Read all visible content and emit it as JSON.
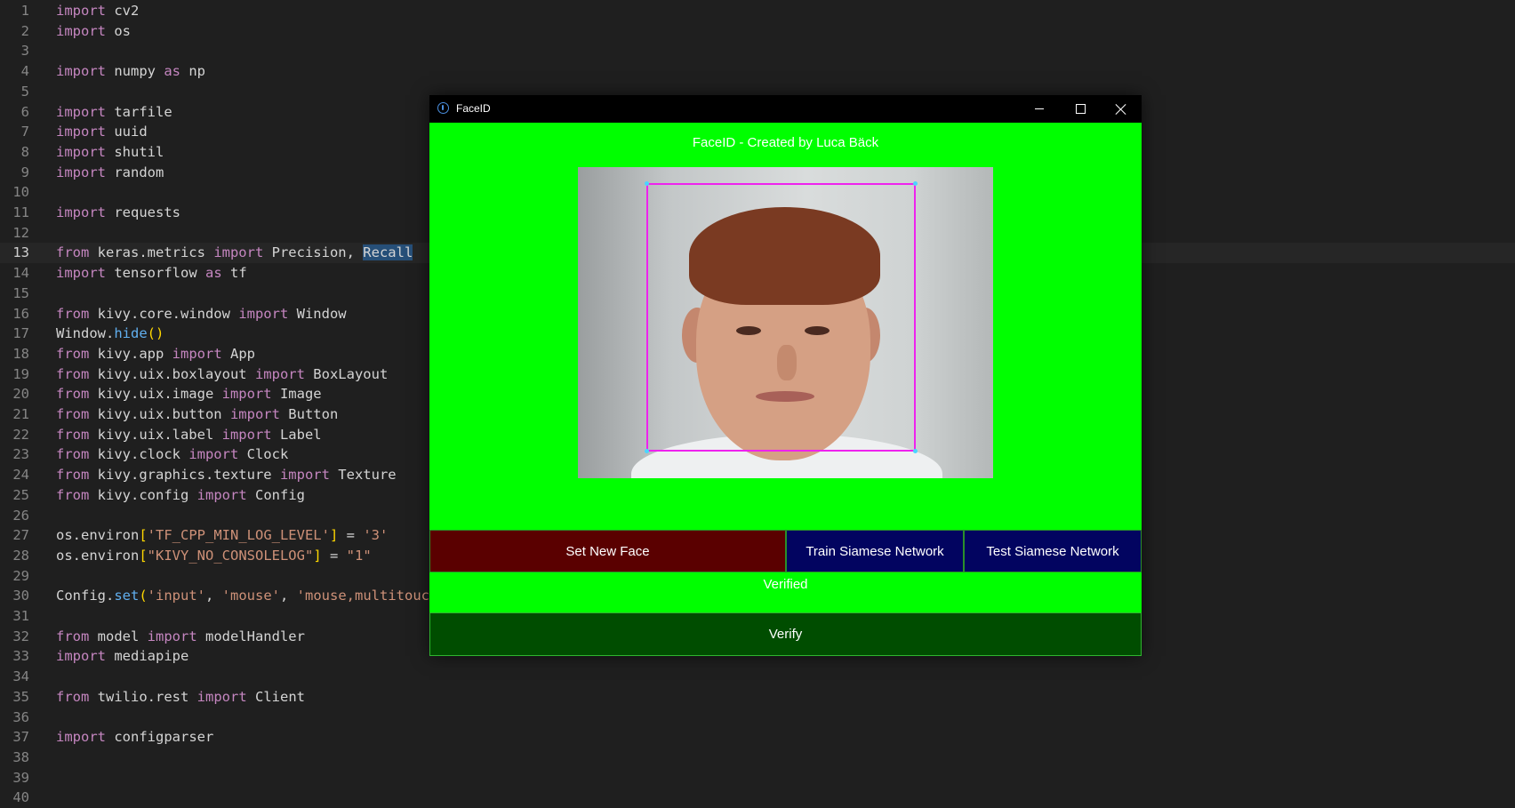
{
  "editor": {
    "current_line": 13,
    "lines": [
      [
        [
          "import",
          "kw"
        ],
        [
          " cv2",
          ""
        ]
      ],
      [
        [
          "import",
          "kw"
        ],
        [
          " os",
          ""
        ]
      ],
      [],
      [
        [
          "import",
          "kw"
        ],
        [
          " numpy ",
          ""
        ],
        [
          "as",
          "kw"
        ],
        [
          " np",
          ""
        ]
      ],
      [],
      [
        [
          "import",
          "kw"
        ],
        [
          " tarfile",
          ""
        ]
      ],
      [
        [
          "import",
          "kw"
        ],
        [
          " uuid",
          ""
        ]
      ],
      [
        [
          "import",
          "kw"
        ],
        [
          " shutil",
          ""
        ]
      ],
      [
        [
          "import",
          "kw"
        ],
        [
          " random",
          ""
        ]
      ],
      [],
      [
        [
          "import",
          "kw"
        ],
        [
          " requests",
          ""
        ]
      ],
      [],
      [
        [
          "from",
          "kw"
        ],
        [
          " keras.metrics ",
          ""
        ],
        [
          "import",
          "kw"
        ],
        [
          " Precision, ",
          ""
        ],
        [
          "Recall",
          "sel"
        ]
      ],
      [
        [
          "import",
          "kw"
        ],
        [
          " tensorflow ",
          ""
        ],
        [
          "as",
          "kw"
        ],
        [
          " tf",
          ""
        ]
      ],
      [],
      [
        [
          "from",
          "kw"
        ],
        [
          " kivy.core.window ",
          ""
        ],
        [
          "import",
          "kw"
        ],
        [
          " Window",
          ""
        ]
      ],
      [
        [
          "Window.",
          ""
        ],
        [
          "hide",
          "fn"
        ],
        [
          "()",
          "par"
        ]
      ],
      [
        [
          "from",
          "kw"
        ],
        [
          " kivy.app ",
          ""
        ],
        [
          "import",
          "kw"
        ],
        [
          " App",
          ""
        ]
      ],
      [
        [
          "from",
          "kw"
        ],
        [
          " kivy.uix.boxlayout ",
          ""
        ],
        [
          "import",
          "kw"
        ],
        [
          " BoxLayout",
          ""
        ]
      ],
      [
        [
          "from",
          "kw"
        ],
        [
          " kivy.uix.image ",
          ""
        ],
        [
          "import",
          "kw"
        ],
        [
          " Image",
          ""
        ]
      ],
      [
        [
          "from",
          "kw"
        ],
        [
          " kivy.uix.button ",
          ""
        ],
        [
          "import",
          "kw"
        ],
        [
          " Button",
          ""
        ]
      ],
      [
        [
          "from",
          "kw"
        ],
        [
          " kivy.uix.label ",
          ""
        ],
        [
          "import",
          "kw"
        ],
        [
          " Label",
          ""
        ]
      ],
      [
        [
          "from",
          "kw"
        ],
        [
          " kivy.clock ",
          ""
        ],
        [
          "import",
          "kw"
        ],
        [
          " Clock",
          ""
        ]
      ],
      [
        [
          "from",
          "kw"
        ],
        [
          " kivy.graphics.texture ",
          ""
        ],
        [
          "import",
          "kw"
        ],
        [
          " Texture",
          ""
        ]
      ],
      [
        [
          "from",
          "kw"
        ],
        [
          " kivy.config ",
          ""
        ],
        [
          "import",
          "kw"
        ],
        [
          " Config",
          ""
        ]
      ],
      [],
      [
        [
          "os.environ",
          ""
        ],
        [
          "[",
          "par"
        ],
        [
          "'TF_CPP_MIN_LOG_LEVEL'",
          "str"
        ],
        [
          "]",
          "par"
        ],
        [
          " = ",
          ""
        ],
        [
          "'3'",
          "str"
        ]
      ],
      [
        [
          "os.environ",
          ""
        ],
        [
          "[",
          "par"
        ],
        [
          "\"KIVY_NO_CONSOLELOG\"",
          "str"
        ],
        [
          "]",
          "par"
        ],
        [
          " = ",
          ""
        ],
        [
          "\"1\"",
          "str"
        ]
      ],
      [],
      [
        [
          "Config.",
          ""
        ],
        [
          "set",
          "fn"
        ],
        [
          "(",
          "par"
        ],
        [
          "'input'",
          "str"
        ],
        [
          ", ",
          ""
        ],
        [
          "'mouse'",
          "str"
        ],
        [
          ", ",
          ""
        ],
        [
          "'mouse,multitouch",
          "str"
        ]
      ],
      [],
      [
        [
          "from",
          "kw"
        ],
        [
          " model ",
          ""
        ],
        [
          "import",
          "kw"
        ],
        [
          " modelHandler",
          ""
        ]
      ],
      [
        [
          "import",
          "kw"
        ],
        [
          " mediapipe",
          ""
        ]
      ],
      [],
      [
        [
          "from",
          "kw"
        ],
        [
          " twilio.rest ",
          ""
        ],
        [
          "import",
          "kw"
        ],
        [
          " Client",
          ""
        ]
      ],
      [],
      [
        [
          "import",
          "kw"
        ],
        [
          " configparser",
          ""
        ]
      ],
      [],
      [],
      []
    ]
  },
  "window": {
    "title": "FaceID",
    "heading": "FaceID - Created by Luca Bäck",
    "buttons": {
      "set_new_face": "Set New Face",
      "train": "Train Siamese Network",
      "test": "Test Siamese Network",
      "verify": "Verify"
    },
    "status": "Verified"
  }
}
